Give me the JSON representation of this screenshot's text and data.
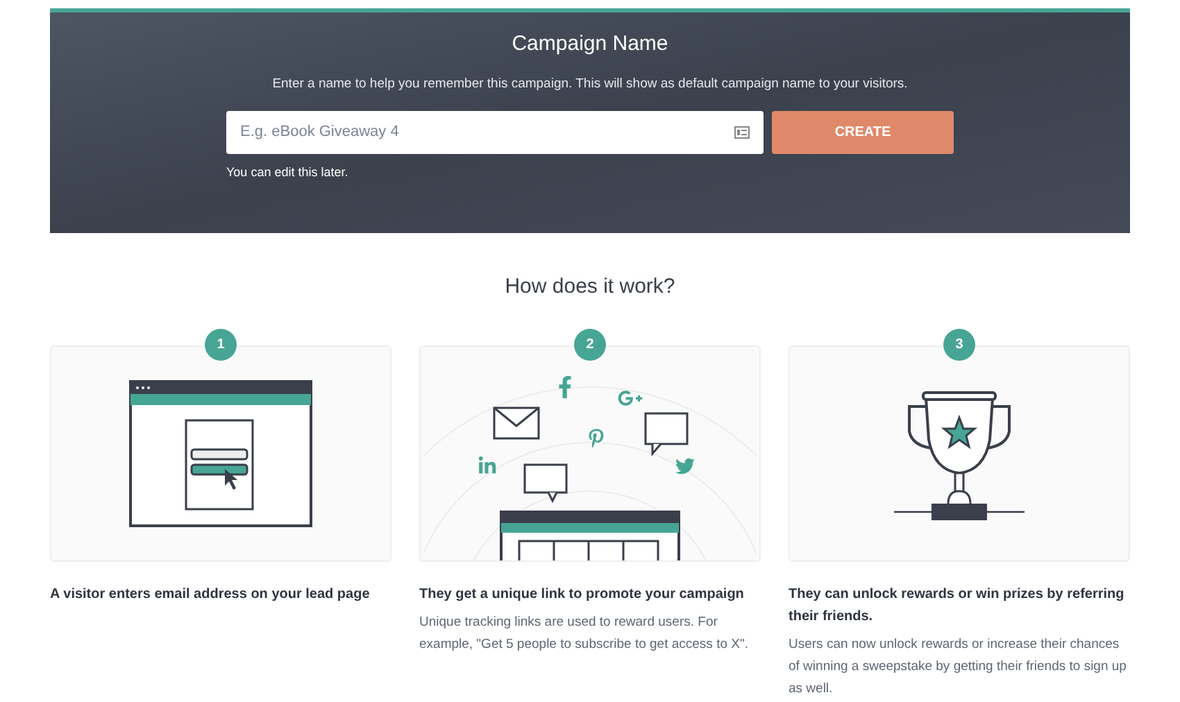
{
  "campaign": {
    "title": "Campaign Name",
    "subtitle": "Enter a name to help you remember this campaign. This will show as default campaign name to your visitors.",
    "input": {
      "placeholder": "E.g. eBook Giveaway 4"
    },
    "button": "CREATE",
    "hint": "You can edit this later."
  },
  "how": {
    "title": "How does it work?",
    "steps": [
      {
        "kind": "signup",
        "number": "1",
        "heading": "A visitor enters email address on your lead page"
      },
      {
        "kind": "share",
        "number": "2",
        "heading": "They get a unique link to promote your campaign",
        "text": "Unique tracking links are used to reward users. For example, \"Get 5 people to subscribe to get access to X\"."
      },
      {
        "kind": "trophy",
        "number": "3",
        "heading": "They can unlock rewards or win prizes by referring their friends.",
        "text": "Users can now unlock rewards or increase their chances of winning a sweepstake by getting their friends to sign up as well."
      }
    ]
  }
}
